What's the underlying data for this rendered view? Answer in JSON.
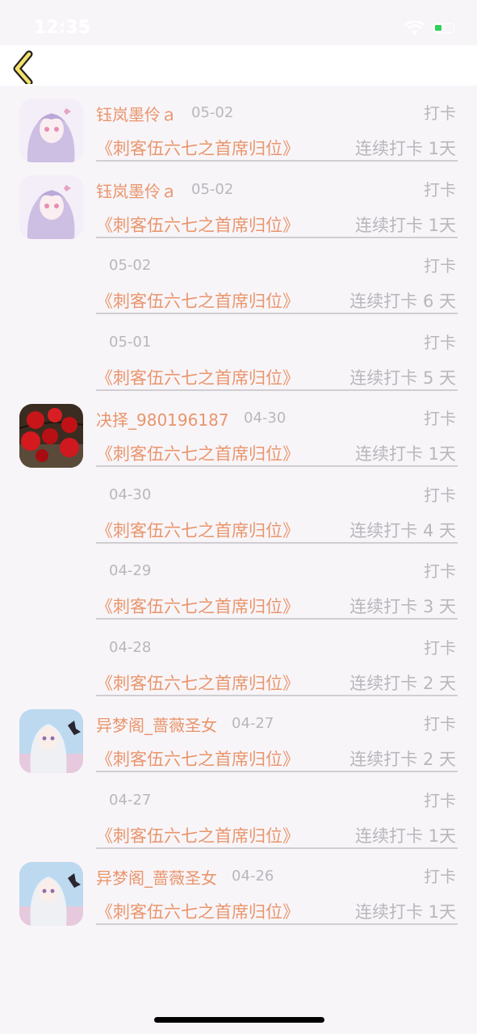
{
  "status": {
    "time": "12:35"
  },
  "nav": {
    "back_icon": "chevron-left-icon",
    "accent": "#f5e06a"
  },
  "entries": [
    {
      "name": "钰岚墨伶ａ",
      "date": "05-02",
      "action": "打卡",
      "book": "《刺客伍六七之首席归位》",
      "streak": "连续打卡 1天",
      "avatar": "anime-girl-lavender"
    },
    {
      "name": "钰岚墨伶ａ",
      "date": "05-02",
      "action": "打卡",
      "book": "《刺客伍六七之首席归位》",
      "streak": "连续打卡 1天",
      "avatar": "anime-girl-lavender"
    },
    {
      "name": "",
      "date": "05-02",
      "action": "打卡",
      "book": "《刺客伍六七之首席归位》",
      "streak": "连续打卡 6 天",
      "avatar": ""
    },
    {
      "name": "",
      "date": "05-01",
      "action": "打卡",
      "book": "《刺客伍六七之首席归位》",
      "streak": "连续打卡 5 天",
      "avatar": ""
    },
    {
      "name": "决择_980196187",
      "date": "04-30",
      "action": "打卡",
      "book": "《刺客伍六七之首席归位》",
      "streak": "连续打卡 1天",
      "avatar": "red-lanterns"
    },
    {
      "name": "",
      "date": "04-30",
      "action": "打卡",
      "book": "《刺客伍六七之首席归位》",
      "streak": "连续打卡 4 天",
      "avatar": ""
    },
    {
      "name": "",
      "date": "04-29",
      "action": "打卡",
      "book": "《刺客伍六七之首席归位》",
      "streak": "连续打卡 3 天",
      "avatar": ""
    },
    {
      "name": "",
      "date": "04-28",
      "action": "打卡",
      "book": "《刺客伍六七之首席归位》",
      "streak": "连续打卡 2 天",
      "avatar": ""
    },
    {
      "name": "异梦阁_蔷薇圣女",
      "date": "04-27",
      "action": "打卡",
      "book": "《刺客伍六七之首席归位》",
      "streak": "连续打卡 2 天",
      "avatar": "anime-girl-white"
    },
    {
      "name": "",
      "date": "04-27",
      "action": "打卡",
      "book": "《刺客伍六七之首席归位》",
      "streak": "连续打卡 1天",
      "avatar": ""
    },
    {
      "name": "异梦阁_蔷薇圣女",
      "date": "04-26",
      "action": "打卡",
      "book": "《刺客伍六七之首席归位》",
      "streak": "连续打卡 1天",
      "avatar": "anime-girl-white"
    }
  ],
  "colors": {
    "accent_orange": "#e9956b",
    "muted_gray": "#b9b6bc",
    "background": "#f8f5f9"
  }
}
